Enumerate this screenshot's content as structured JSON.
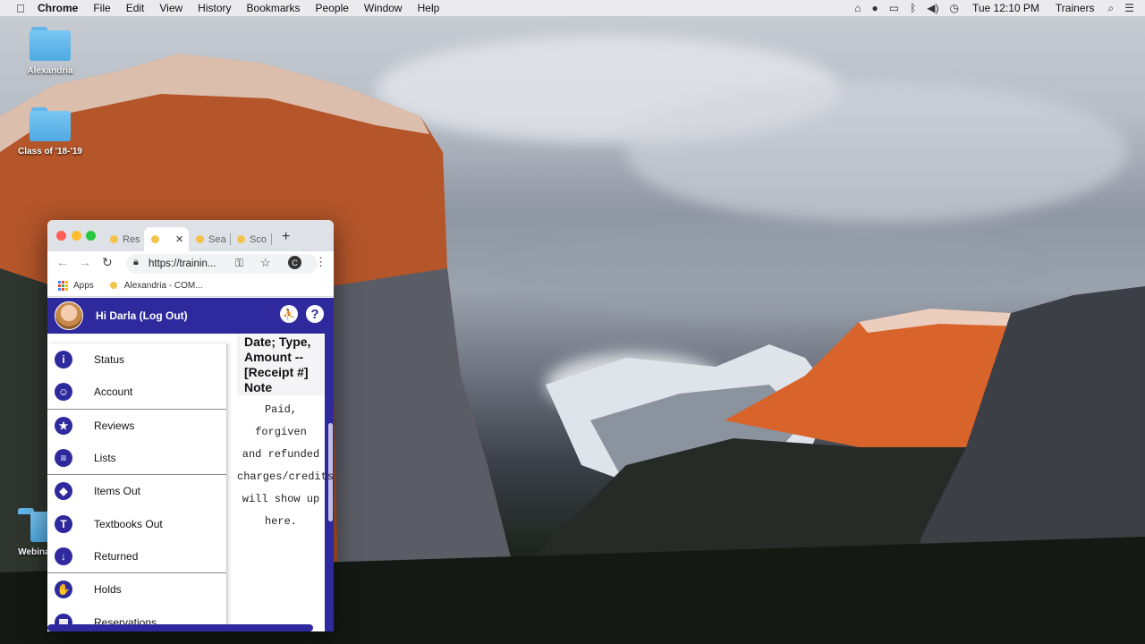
{
  "menubar": {
    "app": "Chrome",
    "items": [
      "File",
      "Edit",
      "View",
      "History",
      "Bookmarks",
      "People",
      "Window",
      "Help"
    ],
    "clock": "Tue 12:10 PM",
    "user": "Trainers"
  },
  "desktop": {
    "icons": [
      {
        "label": "Alexandria"
      },
      {
        "label": "Class of '18-'19"
      },
      {
        "label": "Webina"
      }
    ]
  },
  "browser": {
    "tabs": [
      "Res",
      "",
      "Sea",
      "Sco"
    ],
    "close_glyph": "×",
    "new_tab_glyph": "+",
    "url": "https://trainin...",
    "profile_initial": "C",
    "bookmarks": [
      "Apps",
      "Alexandria - COM..."
    ]
  },
  "app": {
    "greeting": "Hi Darla (Log Out)",
    "history_header": "Date; Type, Amount -- [Receipt #] Note",
    "history_note": "Paid, forgiven\nand refunded\ncharges/credits\nwill show up\nhere.",
    "menu": [
      {
        "label": "Status",
        "glyph": "i"
      },
      {
        "label": "Account",
        "glyph": "☺"
      },
      {
        "label": "Reviews",
        "glyph": "★"
      },
      {
        "label": "Lists",
        "glyph": "≡"
      },
      {
        "label": "Items Out",
        "glyph": "◆"
      },
      {
        "label": "Textbooks Out",
        "glyph": "T"
      },
      {
        "label": "Returned",
        "glyph": "↓"
      },
      {
        "label": "Holds",
        "glyph": "✋"
      },
      {
        "label": "Reservations",
        "glyph": "▦"
      }
    ]
  }
}
